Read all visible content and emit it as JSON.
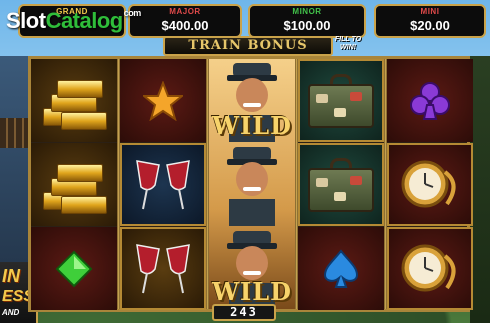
{
  "watermark": {
    "slot": "Slot",
    "catalog": "Catalog",
    "com": "com"
  },
  "jackpots": [
    {
      "label": "GRAND",
      "value": ""
    },
    {
      "label": "MAJOR",
      "value": "$400.00"
    },
    {
      "label": "MINOR",
      "value": "$100.00"
    },
    {
      "label": "MINI",
      "value": "$20.00"
    }
  ],
  "bonus_banner": {
    "title": "TRAIN BONUS",
    "subtitle": "FILL TO WIN!"
  },
  "reels": [
    [
      "gold-bars",
      "gold-bars",
      "green-diamond"
    ],
    [
      "orange-star",
      "wine-glasses",
      "wine-glasses"
    ],
    [
      "wild",
      "wild",
      "wild"
    ],
    [
      "suitcase",
      "suitcase",
      "blue-spade"
    ],
    [
      "purple-club",
      "pocket-watch",
      "pocket-watch"
    ]
  ],
  "wild_label": "WILD",
  "counter": "243",
  "side_logo": {
    "line1": "IN",
    "line2": "ESS",
    "line3": "AND"
  },
  "colors": {
    "frame_gold": "#c9a24a",
    "grand": "#f2c94c",
    "major": "#e04a4a",
    "minor": "#41c24a",
    "mini": "#e04a4a"
  }
}
